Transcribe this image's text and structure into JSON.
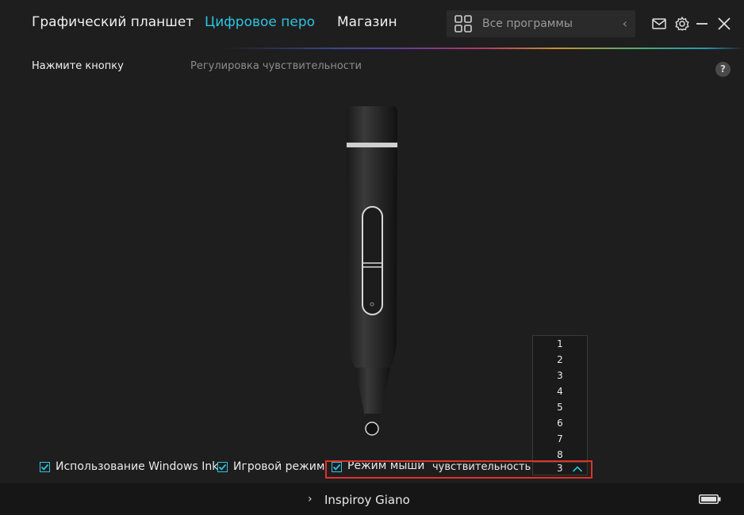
{
  "header": {
    "tabs": [
      {
        "label": "Графический планшет",
        "active": false
      },
      {
        "label": "Цифровое перо",
        "active": true
      },
      {
        "label": "Магазин",
        "active": false
      }
    ],
    "search": {
      "label": "Все программы"
    },
    "accent_color": "#2ec3e0"
  },
  "subnav": {
    "items": [
      {
        "label": "Нажмите кнопку",
        "active": true
      },
      {
        "label": "Регулировка чувствительности",
        "active": false
      }
    ],
    "help": "?"
  },
  "options": {
    "windows_ink": {
      "label": "Использование Windows Ink",
      "checked": true
    },
    "game_mode": {
      "label": "Игровой режим",
      "checked": true
    },
    "mouse_mode": {
      "label": "Режим мыши",
      "checked": true
    },
    "sensitivity_label": "чувствительность",
    "sensitivity_value": "3",
    "sensitivity_options": [
      "1",
      "2",
      "3",
      "4",
      "5",
      "6",
      "7",
      "8"
    ]
  },
  "footer": {
    "device": "Inspiroy Giano"
  },
  "colors": {
    "highlight": "#e0312b",
    "background": "#1e1e1e"
  }
}
